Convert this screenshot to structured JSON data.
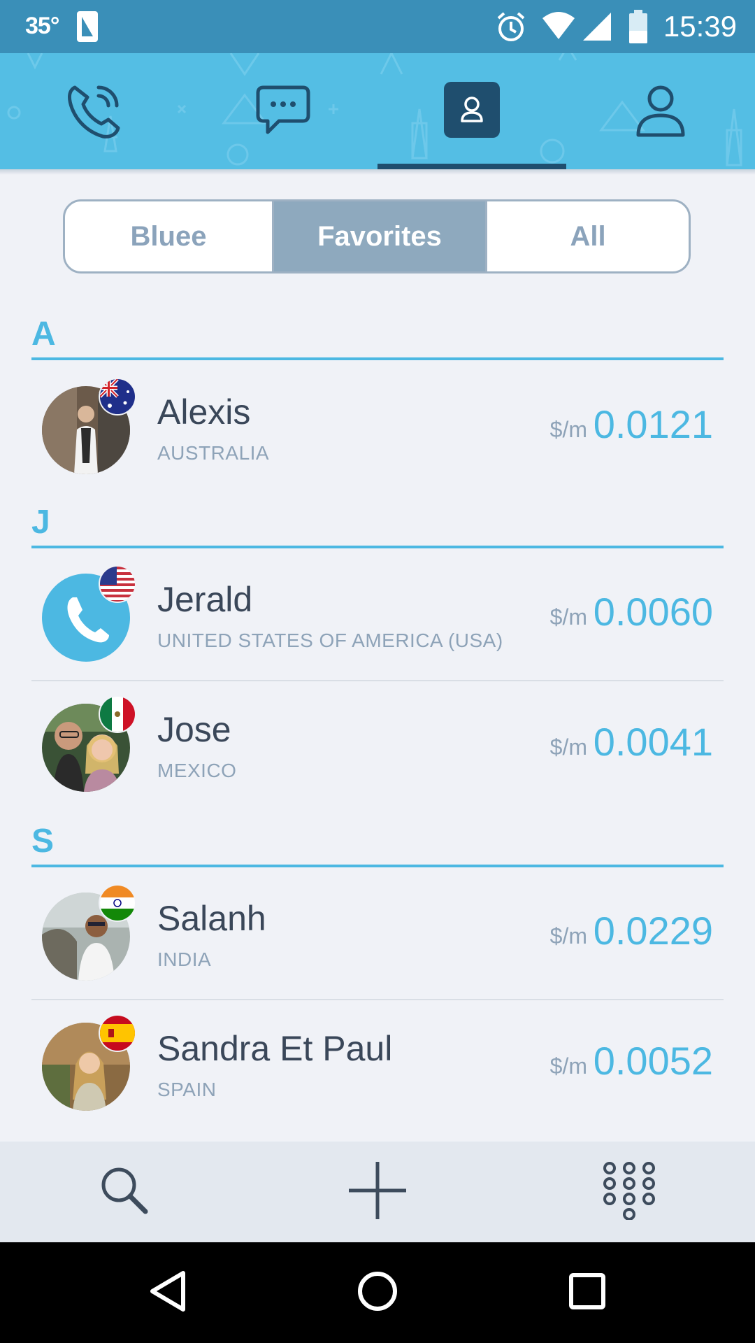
{
  "status_bar": {
    "temperature": "35°",
    "time": "15:39",
    "icons": [
      "sim-card-icon",
      "alarm-icon",
      "wifi-icon",
      "signal-icon",
      "battery-icon"
    ]
  },
  "top_tabs": [
    {
      "icon": "phone-calls-icon",
      "selected": false
    },
    {
      "icon": "chat-bubble-icon",
      "selected": false
    },
    {
      "icon": "contacts-icon",
      "selected": true
    },
    {
      "icon": "profile-icon",
      "selected": false
    }
  ],
  "segmented": {
    "options": [
      "Bluee",
      "Favorites",
      "All"
    ],
    "selected": "Favorites"
  },
  "sections": [
    {
      "letter": "A",
      "contacts": [
        {
          "name": "Alexis",
          "country": "AUSTRALIA",
          "rate_unit": "$/m",
          "rate": "0.0121",
          "flag": "australia-flag-icon"
        }
      ]
    },
    {
      "letter": "J",
      "contacts": [
        {
          "name": "Jerald",
          "country": "UNITED STATES OF AMERICA (USA)",
          "rate_unit": "$/m",
          "rate": "0.0060",
          "flag": "usa-flag-icon"
        },
        {
          "name": "Jose",
          "country": "MEXICO",
          "rate_unit": "$/m",
          "rate": "0.0041",
          "flag": "mexico-flag-icon"
        }
      ]
    },
    {
      "letter": "S",
      "contacts": [
        {
          "name": "Salanh",
          "country": "INDIA",
          "rate_unit": "$/m",
          "rate": "0.0229",
          "flag": "india-flag-icon"
        },
        {
          "name": "Sandra Et Paul",
          "country": "SPAIN",
          "rate_unit": "$/m",
          "rate": "0.0052",
          "flag": "spain-flag-icon"
        }
      ]
    }
  ],
  "bottom_bar": {
    "icons": [
      "search-icon",
      "add-icon",
      "dialpad-icon"
    ]
  },
  "nav_bar": {
    "icons": [
      "back-icon",
      "home-icon",
      "recents-icon"
    ]
  },
  "colors": {
    "status_bar": "#3a8fb8",
    "tab_bar": "#54bee4",
    "accent": "#4cb8e2",
    "segment_selected": "#8ea9be"
  }
}
